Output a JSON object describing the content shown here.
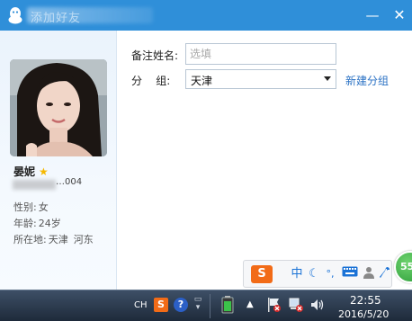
{
  "dialog": {
    "title": "添加好友",
    "minimize_glyph": "—",
    "close_glyph": "✕"
  },
  "profile": {
    "name": "晏妮",
    "qq_suffix": "…004",
    "gender_label": "性别:",
    "gender": "女",
    "age_label": "年龄:",
    "age": "24岁",
    "location_label": "所在地:",
    "location_city": "天津",
    "location_district": "河东",
    "star_icon": "star-icon"
  },
  "form": {
    "remark_label": "备注姓名:",
    "remark_value": "",
    "remark_placeholder": "选填",
    "group_label": "分    组:",
    "group_value": "天津",
    "new_group_label": "新建分组"
  },
  "ime": {
    "logo": "S",
    "chinese": "中",
    "punct": "°,",
    "green_badge": "55"
  },
  "taskbar": {
    "lang": "CH",
    "time": "22:55",
    "date": "2016/5/20"
  },
  "colors": {
    "titlebar": "#2f8fd9",
    "link": "#2a71c4",
    "ime_logo": "#f26b17"
  }
}
